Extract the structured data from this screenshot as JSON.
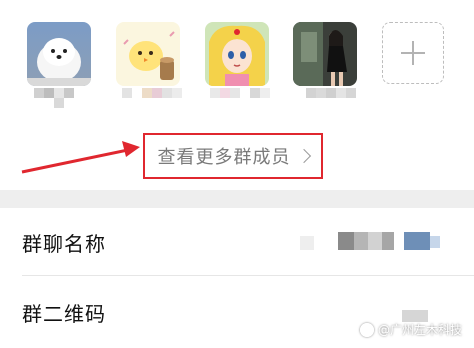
{
  "members": {
    "avatars": [
      {
        "name": "dog-avatar"
      },
      {
        "name": "chick-avatar"
      },
      {
        "name": "anime-girl-avatar"
      },
      {
        "name": "photo-avatar"
      }
    ],
    "add_icon": "plus-icon",
    "view_more_label": "查看更多群成员",
    "view_more_icon": "chevron-right-icon"
  },
  "settings": {
    "group_name_label": "群聊名称",
    "qr_code_label": "群二维码"
  },
  "annotation": {
    "arrow_color": "#e0272f",
    "highlight_color": "#e0272f"
  },
  "watermark": {
    "text": "@广州左木科技"
  }
}
